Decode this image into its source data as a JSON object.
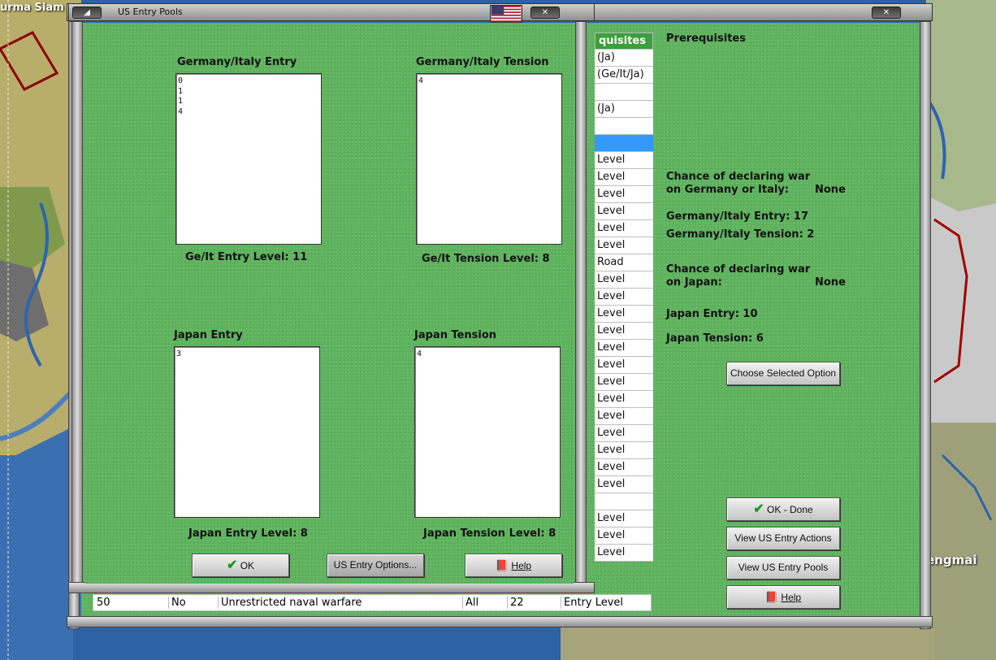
{
  "map": {
    "label_top_left": "urma Siam",
    "label_right": "engmai"
  },
  "back_window": {
    "table_header": "quisites",
    "table_cells": [
      "(Ja)",
      "(Ge/It/Ja)",
      "",
      "(Ja)",
      "",
      "",
      "Level",
      "Level",
      "Level",
      "Level",
      "Level",
      "Level",
      " Road",
      "Level",
      "Level",
      "Level",
      "Level",
      "Level",
      "Level",
      "Level",
      "Level",
      "Level",
      "Level",
      "Level",
      "Level",
      "Level",
      "",
      "Level",
      "Level",
      "Level"
    ],
    "bottom_row": {
      "number": "50",
      "yesno": "No",
      "name": "Unrestricted naval warfare",
      "target": "All",
      "cost": "22",
      "type": "Entry Level"
    },
    "prereq_title": "Prerequisites",
    "chance_ge_line1": "Chance of declaring war",
    "chance_ge_line2": "on Germany or Italy:",
    "chance_ge_value": "None",
    "ge_entry": "Germany/Italy Entry: 17",
    "ge_tension": "Germany/Italy Tension: 2",
    "chance_ja_line1": "Chance of declaring war",
    "chance_ja_line2": "on Japan:",
    "chance_ja_value": "None",
    "ja_entry": "Japan Entry: 10",
    "ja_tension": "Japan Tension: 6",
    "choose_button": "Choose Selected Option",
    "ok_done_button": "OK - Done",
    "view_actions_button": "View US Entry Actions",
    "view_pools_button": "View US Entry Pools",
    "help_button": "Help"
  },
  "front_window": {
    "title": "US Entry Pools",
    "ge_entry_title": "Germany/Italy Entry",
    "ge_entry_values": "0\n1\n1\n4",
    "ge_entry_level": "Ge/It Entry Level: 11",
    "ge_tension_title": "Germany/Italy Tension",
    "ge_tension_values": "4",
    "ge_tension_level": "Ge/It Tension Level: 8",
    "ja_entry_title": "Japan Entry",
    "ja_entry_values": "3",
    "ja_entry_level": "Japan Entry Level: 8",
    "ja_tension_title": "Japan Tension",
    "ja_tension_values": "4",
    "ja_tension_level": "Japan Tension Level: 8",
    "ok_button": "OK",
    "options_button": "US Entry Options...",
    "help_button": "Help"
  },
  "colors": {
    "panel_green": "#5fb35f",
    "table_header_green": "#3aa03a",
    "selection_blue": "#3399ff",
    "check_green": "#1a9a1a"
  }
}
